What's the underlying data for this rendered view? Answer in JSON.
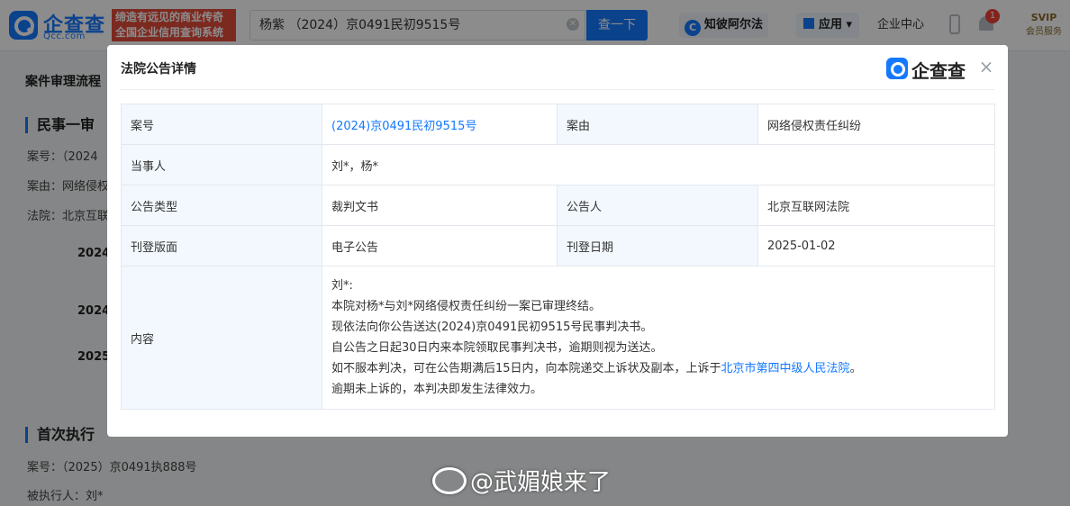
{
  "header": {
    "logo_text": "企查查",
    "logo_sub": "Qcc.com",
    "slogan_line1": "缔造有远见的商业传奇",
    "slogan_line2": "全国企业信用查询系统",
    "search_value": "杨紫 （2024）京0491民初9515号",
    "search_button": "查一下",
    "zhibi_label": "知彼阿尔法",
    "apps_label": "应用",
    "enterprise_center": "企业中心",
    "notification_count": "1",
    "svip_top": "SVIP",
    "svip_bottom": "会员服务",
    "brand_color": "#1479ff"
  },
  "background": {
    "flow_title": "案件审理流程",
    "section1_title": "民事一审",
    "case_no_line": "案号：（2024",
    "cause_line": "案由：网络侵权",
    "court_line": "法院：北京互联",
    "date1": "2024",
    "date2": "2024",
    "date3": "2025",
    "section2_title": "首次执行",
    "exec_case_no": "案号：（2025）京0491执888号",
    "exec_person": "被执行人：刘*"
  },
  "modal": {
    "title": "法院公告详情",
    "logo_text": "企查查",
    "close_icon": "×",
    "rows": {
      "case_no_label": "案号",
      "case_no_value": "(2024)京0491民初9515号",
      "cause_label": "案由",
      "cause_value": "网络侵权责任纠纷",
      "party_label": "当事人",
      "party_value": "刘*，杨*",
      "type_label": "公告类型",
      "type_value": "裁判文书",
      "announcer_label": "公告人",
      "announcer_value": "北京互联网法院",
      "section_label": "刊登版面",
      "section_value": "电子公告",
      "date_label": "刊登日期",
      "date_value": "2025-01-02",
      "content_label": "内容",
      "content_line1": "刘*:",
      "content_line2": "本院对杨*与刘*网络侵权责任纠纷一案已审理终结。",
      "content_line3": "现依法向你公告送达(2024)京0491民初9515号民事判决书。",
      "content_line4": "自公告之日起30日内来本院领取民事判决书，逾期则视为送达。",
      "content_line5_pre": "如不服本判决，可在公告期满后15日内，向本院递交上诉状及副本，上诉于",
      "content_line5_link": "北京市第四中级人民法院",
      "content_line5_post": "。",
      "content_line6": "逾期未上诉的，本判决即发生法律效力。"
    }
  },
  "watermark": "@武媚娘来了"
}
